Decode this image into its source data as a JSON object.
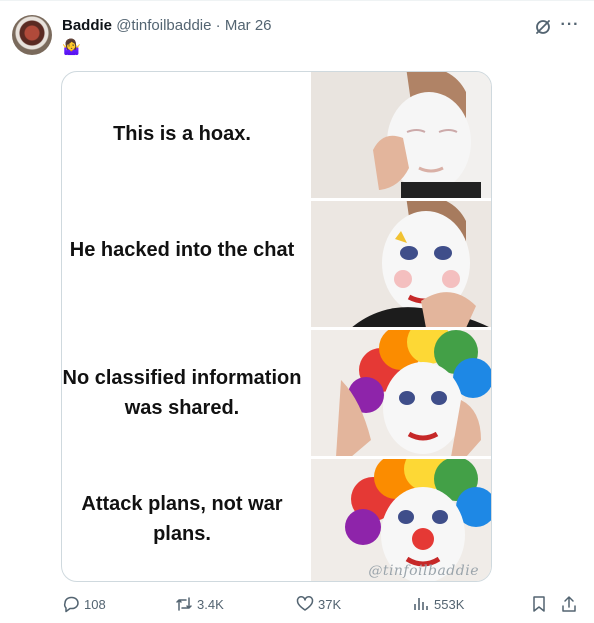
{
  "tweet": {
    "display_name": "Baddie",
    "handle": "@tinfoilbaddie",
    "separator": "·",
    "date": "Mar 26",
    "emoji": "🤷‍♀️"
  },
  "media": {
    "panels": [
      {
        "text": "This is a hoax."
      },
      {
        "text": "He hacked into the chat"
      },
      {
        "text": "No classified information was shared."
      },
      {
        "text": "Attack plans, not war plans."
      }
    ],
    "watermark": "@tinfoilbaddie"
  },
  "actions": {
    "replies": "108",
    "reposts": "3.4K",
    "likes": "37K",
    "views": "553K"
  },
  "icons": {
    "avatar": "avatar",
    "grok": "grok-icon",
    "more": "more-icon",
    "reply": "reply-icon",
    "repost": "repost-icon",
    "like": "heart-icon",
    "views": "views-icon",
    "bookmark": "bookmark-icon",
    "share": "share-icon"
  },
  "colors": {
    "text": "#0f1419",
    "secondary": "#536471",
    "border": "#cfd9de"
  }
}
